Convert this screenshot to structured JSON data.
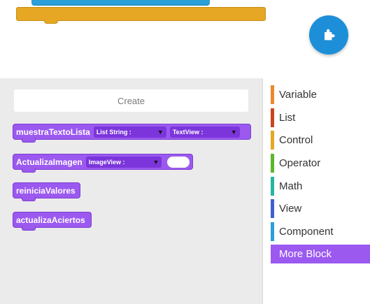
{
  "palette": {
    "create_label": "Create",
    "blocks": [
      {
        "name": "muestraTextoLista",
        "params": [
          "List String :",
          "TextView :"
        ]
      },
      {
        "name": "ActualizaImagen",
        "params": [
          "ImageView :"
        ]
      },
      {
        "name": "reiniciaValores"
      },
      {
        "name": "actualizaAciertos"
      }
    ]
  },
  "categories": [
    {
      "label": "Variable",
      "color": "#e98a2c"
    },
    {
      "label": "List",
      "color": "#c8461f"
    },
    {
      "label": "Control",
      "color": "#e6a724"
    },
    {
      "label": "Operator",
      "color": "#5cb72b"
    },
    {
      "label": "Math",
      "color": "#25b7a0"
    },
    {
      "label": "View",
      "color": "#3f5fcf"
    },
    {
      "label": "Component",
      "color": "#2a9fd8"
    },
    {
      "label": "More Block",
      "color": "#9b59f0",
      "selected": true
    }
  ],
  "fab": {
    "icon": "puzzle-icon",
    "color": "#1d8fd8"
  }
}
